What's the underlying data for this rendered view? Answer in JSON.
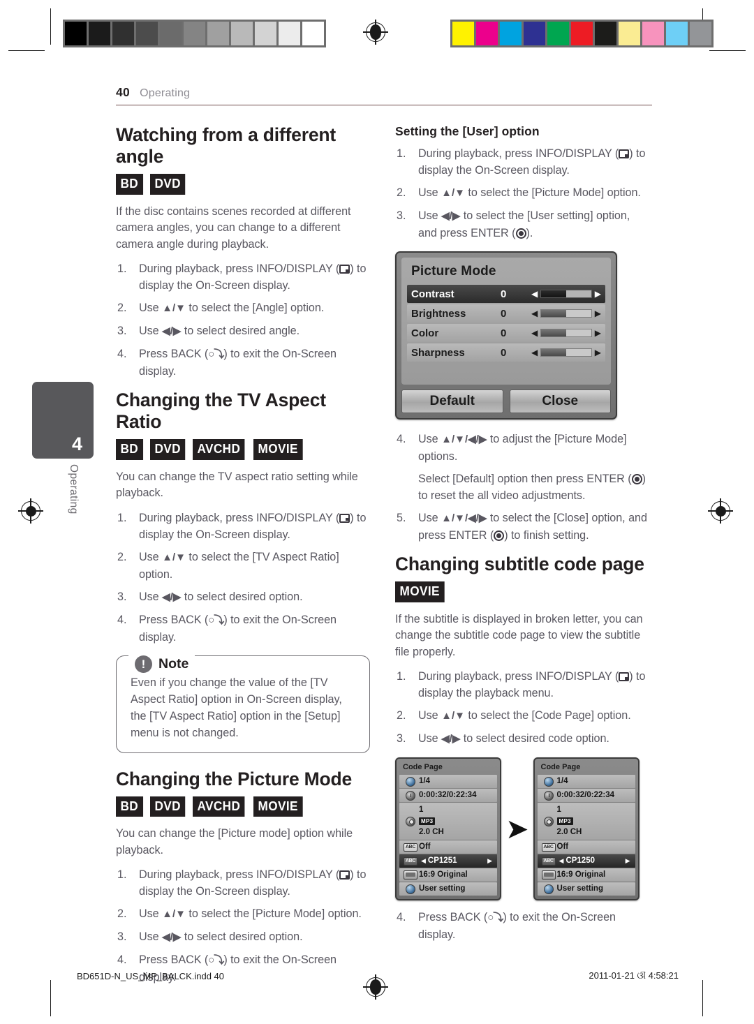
{
  "header": {
    "page_number": "40",
    "section": "Operating"
  },
  "chapter_tab": {
    "number": "4",
    "label": "Operating"
  },
  "left_column": {
    "section1": {
      "title": "Watching from a different angle",
      "badges": [
        "BD",
        "DVD"
      ],
      "intro": "If the disc contains scenes recorded at different camera angles, you can change to a different camera angle during playback.",
      "steps": [
        {
          "n": "1.",
          "pre": "During playback, press INFO/DISPLAY (",
          "icon": "display-icon",
          "post": ") to display the On-Screen display."
        },
        {
          "n": "2.",
          "pre": "Use ",
          "keys": "▲/▼",
          "post": " to select the [Angle] option."
        },
        {
          "n": "3.",
          "pre": "Use ",
          "keys": "◀/▶",
          "post": " to select desired angle."
        },
        {
          "n": "4.",
          "pre": "Press BACK (",
          "icon": "back-icon",
          "post": ") to exit the On-Screen display."
        }
      ]
    },
    "section2": {
      "title": "Changing the TV Aspect Ratio",
      "badges": [
        "BD",
        "DVD",
        "AVCHD",
        "MOVIE"
      ],
      "intro": "You can change the TV aspect ratio setting while playback.",
      "steps": [
        {
          "n": "1.",
          "pre": "During playback, press INFO/DISPLAY (",
          "icon": "display-icon",
          "post": ") to display the On-Screen display."
        },
        {
          "n": "2.",
          "pre": "Use ",
          "keys": "▲/▼",
          "post": " to select the [TV Aspect Ratio] option."
        },
        {
          "n": "3.",
          "pre": "Use ",
          "keys": "◀/▶",
          "post": " to select desired option."
        },
        {
          "n": "4.",
          "pre": "Press BACK (",
          "icon": "back-icon",
          "post": ") to exit the On-Screen display."
        }
      ]
    },
    "note": {
      "label": "Note",
      "icon_char": "!",
      "text": "Even if you change the value of the [TV Aspect Ratio] option in On-Screen display, the [TV Aspect Ratio] option in the [Setup] menu is not changed."
    },
    "section3": {
      "title": "Changing the Picture Mode",
      "badges": [
        "BD",
        "DVD",
        "AVCHD",
        "MOVIE"
      ],
      "intro": "You can change the [Picture mode] option while playback.",
      "steps": [
        {
          "n": "1.",
          "pre": "During playback, press INFO/DISPLAY (",
          "icon": "display-icon",
          "post": ") to display the On-Screen display."
        },
        {
          "n": "2.",
          "pre": "Use ",
          "keys": "▲/▼",
          "post": " to select the [Picture Mode] option."
        },
        {
          "n": "3.",
          "pre": "Use ",
          "keys": "◀/▶",
          "post": " to select desired option."
        },
        {
          "n": "4.",
          "pre": "Press BACK (",
          "icon": "back-icon",
          "post": ") to exit the On-Screen display."
        }
      ]
    }
  },
  "right_column": {
    "section1": {
      "title": "Setting the [User] option",
      "steps": [
        {
          "n": "1.",
          "pre": "During playback, press INFO/DISPLAY (",
          "icon": "display-icon",
          "post": ") to display the On-Screen display."
        },
        {
          "n": "2.",
          "pre": "Use ",
          "keys": "▲/▼",
          "post": " to select the [Picture Mode] option."
        },
        {
          "n": "3.",
          "pre": "Use ",
          "keys": "◀/▶",
          "post": " to select the [User setting] option, and press ENTER (",
          "icon2": "enter-icon",
          "post2": ")."
        }
      ],
      "steps_after": [
        {
          "n": "4.",
          "pre": "Use ",
          "keys": "▲/▼/◀/▶",
          "post": " to adjust the [Picture Mode] options."
        },
        {
          "n": "",
          "pre": "Select [Default] option then press ENTER (",
          "icon2": "enter-icon",
          "post2": ") to reset the all video adjustments."
        },
        {
          "n": "5.",
          "pre": "Use ",
          "keys": "▲/▼/◀/▶",
          "post": " to select the [Close] option, and press ENTER (",
          "icon2": "enter-icon",
          "post2": ") to finish setting."
        }
      ]
    },
    "picture_mode_osd": {
      "title": "Picture Mode",
      "rows": [
        {
          "label": "Contrast",
          "value": "0",
          "fill_percent": 50,
          "selected": true
        },
        {
          "label": "Brightness",
          "value": "0",
          "fill_percent": 50,
          "selected": false
        },
        {
          "label": "Color",
          "value": "0",
          "fill_percent": 50,
          "selected": false
        },
        {
          "label": "Sharpness",
          "value": "0",
          "fill_percent": 50,
          "selected": false
        }
      ],
      "buttons": [
        "Default",
        "Close"
      ]
    },
    "section2": {
      "title": "Changing subtitle code page",
      "badges": [
        "MOVIE"
      ],
      "intro": "If the subtitle is displayed in broken letter, you can change the subtitle code page to view the subtitle file properly.",
      "steps": [
        {
          "n": "1.",
          "pre": "During playback, press INFO/DISPLAY (",
          "icon": "display-icon",
          "post": ") to display the playback menu."
        },
        {
          "n": "2.",
          "pre": "Use ",
          "keys": "▲/▼",
          "post": " to select the [Code Page] option."
        },
        {
          "n": "3.",
          "pre": "Use ",
          "keys": "◀/▶",
          "post": " to select desired code option."
        }
      ],
      "final_step": {
        "n": "4.",
        "pre": "Press BACK (",
        "icon": "back-icon",
        "post": ") to exit the On-Screen display."
      }
    },
    "code_page_osd_left": {
      "title": "Code Page",
      "rows": [
        {
          "icon": "disc-icon",
          "text": "1/4"
        },
        {
          "icon": "clock-icon",
          "text": "0:00:32/0:22:34"
        },
        {
          "icon": "cd-icon",
          "lines": [
            "1",
            "MP3",
            "2.0 CH"
          ]
        },
        {
          "icon": "abc-icon",
          "text": "Off"
        },
        {
          "icon": "codepage-icon",
          "text": "CP1251",
          "selected": true,
          "carets": true
        },
        {
          "icon": "tv-icon",
          "text": "16:9 Original"
        },
        {
          "icon": "globe-icon",
          "text": "User setting"
        }
      ]
    },
    "code_page_osd_right": {
      "title": "Code Page",
      "rows": [
        {
          "icon": "disc-icon",
          "text": "1/4"
        },
        {
          "icon": "clock-icon",
          "text": "0:00:32/0:22:34"
        },
        {
          "icon": "cd-icon",
          "lines": [
            "1",
            "MP3",
            "2.0 CH"
          ]
        },
        {
          "icon": "abc-icon",
          "text": "Off"
        },
        {
          "icon": "codepage-icon",
          "text": "CP1250",
          "selected": true,
          "carets": true
        },
        {
          "icon": "tv-icon",
          "text": "16:9 Original"
        },
        {
          "icon": "globe-icon",
          "text": "User setting"
        }
      ]
    }
  },
  "footer": {
    "filename": "BD651D-N_US_MP_BALCK.indd   40",
    "timestamp": "2011-01-21   ଔ 4:58:21"
  },
  "print_marks": {
    "gray_bar": [
      "#000000",
      "#1b1b1b",
      "#303030",
      "#4c4c4c",
      "#6b6b6b",
      "#848484",
      "#a0a0a0",
      "#b9b9b9",
      "#d3d3d3",
      "#ececec",
      "#ffffff"
    ],
    "color_bar": [
      "#fff200",
      "#ec008c",
      "#00a3e0",
      "#2e3192",
      "#00a650",
      "#ed1c24",
      "#1c1c1a",
      "#faec93",
      "#f793bd",
      "#6ecff6",
      "#939598"
    ]
  }
}
